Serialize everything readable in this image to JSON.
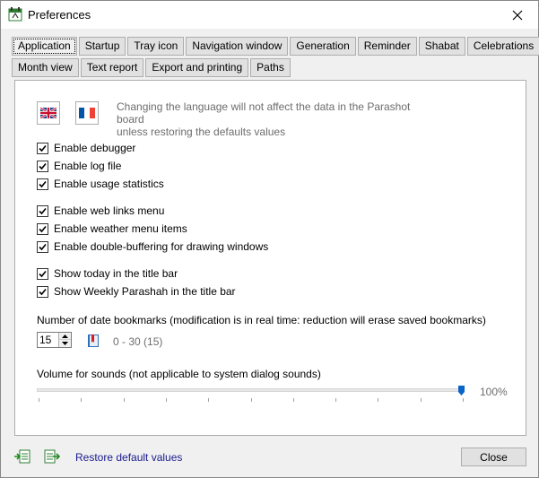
{
  "window": {
    "title": "Preferences",
    "close_glyph": "✕"
  },
  "tabs_row1": [
    {
      "label": "Application",
      "active": true
    },
    {
      "label": "Startup"
    },
    {
      "label": "Tray icon"
    },
    {
      "label": "Navigation window"
    },
    {
      "label": "Generation"
    },
    {
      "label": "Reminder"
    },
    {
      "label": "Shabat"
    },
    {
      "label": "Celebrations"
    }
  ],
  "tabs_row2": [
    {
      "label": "Month view"
    },
    {
      "label": "Text report"
    },
    {
      "label": "Export and printing"
    },
    {
      "label": "Paths"
    }
  ],
  "language": {
    "note_line1": "Changing the language will not affect the data in the Parashot board",
    "note_line2": "unless restoring the defaults values",
    "flags": [
      "uk-flag-icon",
      "france-flag-icon"
    ]
  },
  "checkboxes": [
    {
      "label": "Enable debugger",
      "checked": true
    },
    {
      "label": "Enable log file",
      "checked": true
    },
    {
      "label": "Enable usage statistics",
      "checked": true
    },
    {
      "label": "Enable web links menu",
      "checked": true
    },
    {
      "label": "Enable weather menu items",
      "checked": true
    },
    {
      "label": "Enable double-buffering for drawing windows",
      "checked": true
    },
    {
      "label": "Show today in the title bar",
      "checked": true
    },
    {
      "label": "Show Weekly Parashah in the title bar",
      "checked": true
    }
  ],
  "bookmarks": {
    "label": "Number of date bookmarks (modification is in real time: reduction will erase saved bookmarks)",
    "value": "15",
    "range": "0 - 30 (15)"
  },
  "volume": {
    "label": "Volume for sounds (not applicable to system dialog sounds)",
    "value_text": "100%",
    "value": 1.0
  },
  "footer": {
    "restore_label": "Restore default values",
    "close_label": "Close"
  },
  "colors": {
    "accent": "#0a64c8",
    "link": "#1a1a8c",
    "muted": "#6d6d6d"
  }
}
